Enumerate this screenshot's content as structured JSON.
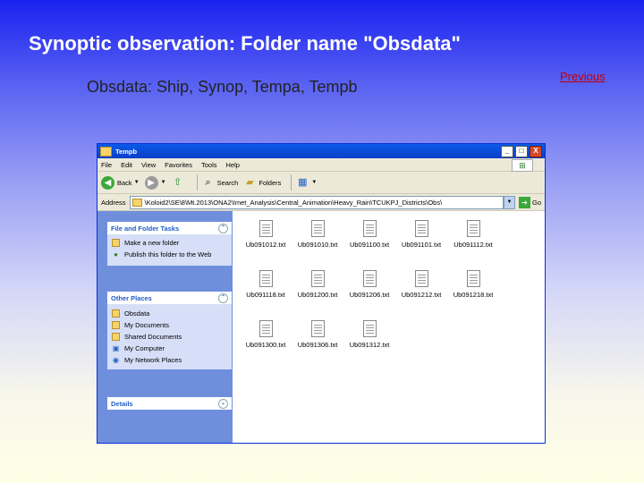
{
  "slide": {
    "title": "Synoptic observation: Folder name \"Obsdata\"",
    "subtitle": "Obsdata: Ship, Synop, Tempa, Tempb",
    "previous_link": "Previous"
  },
  "window": {
    "title": "Tempb",
    "title_buttons": {
      "minimize": "_",
      "maximize": "□",
      "close": "X"
    },
    "menu": [
      "File",
      "Edit",
      "View",
      "Favorites",
      "Tools",
      "Help"
    ],
    "toolbar": {
      "back": "Back",
      "search": "Search",
      "folders": "Folders"
    },
    "address": {
      "label": "Address",
      "value": "\\Koloid2\\SE\\8\\Mt.2013\\ONA2\\Imet_Analysis\\Central_Animation\\Heavy_Rain\\TCUKPJ_Districts\\Obs\\",
      "go": "Go"
    },
    "file_tasks": {
      "header": "File and Folder Tasks",
      "items": [
        "Make a new folder",
        "Publish this folder to the Web"
      ]
    },
    "other_places": {
      "header": "Other Places",
      "items": [
        "Obsdata",
        "My Documents",
        "Shared Documents",
        "My Computer",
        "My Network Places"
      ]
    },
    "details": {
      "header": "Details"
    },
    "files": [
      "Ub091012.txt",
      "Ub091010.txt",
      "Ub091100.txt",
      "Ub091101.txt",
      "Ub091112.txt",
      "Ub091118.txt",
      "Ub091200.txt",
      "Ub091206.txt",
      "Ub091212.txt",
      "Ub091218.txt",
      "Ub091300.txt",
      "Ub091306.txt",
      "Ub091312.txt"
    ]
  },
  "colors": {
    "title_text": "#ffffff",
    "link": "#c00000",
    "xp_blue": "#0a4fd8",
    "task_pane": "#6f8fdc"
  }
}
